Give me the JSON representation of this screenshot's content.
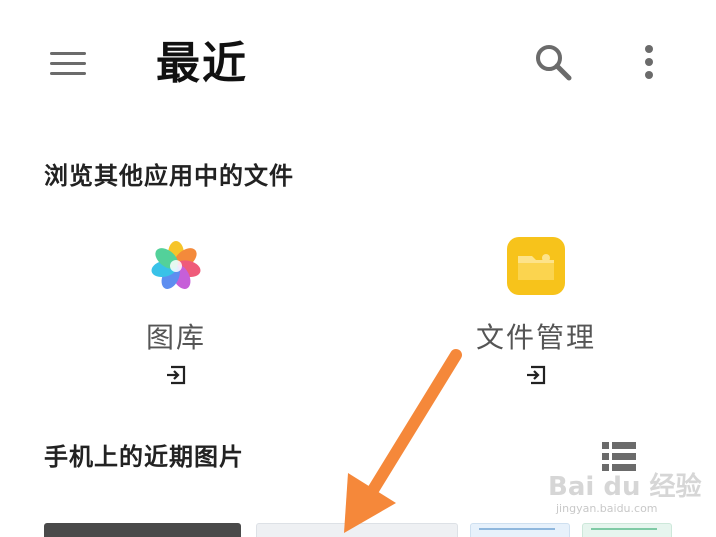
{
  "header": {
    "title": "最近",
    "menu_icon": "hamburger-menu-icon",
    "search_icon": "search-icon",
    "more_icon": "more-vertical-icon"
  },
  "browse_section": {
    "title": "浏览其他应用中的文件",
    "apps": [
      {
        "label": "图库",
        "icon": "gallery-flower-icon"
      },
      {
        "label": "文件管理",
        "icon": "folder-icon"
      }
    ],
    "open_icon": "open-in-app-icon"
  },
  "recent_section": {
    "title": "手机上的近期图片",
    "view_toggle_icon": "list-view-icon"
  },
  "colors": {
    "folder_yellow": "#f7c31b",
    "arrow_orange": "#f5883a",
    "icon_gray": "#6b6b6b"
  },
  "watermark": {
    "logo": "Bai du 经验",
    "url": "jingyan.baidu.com"
  }
}
